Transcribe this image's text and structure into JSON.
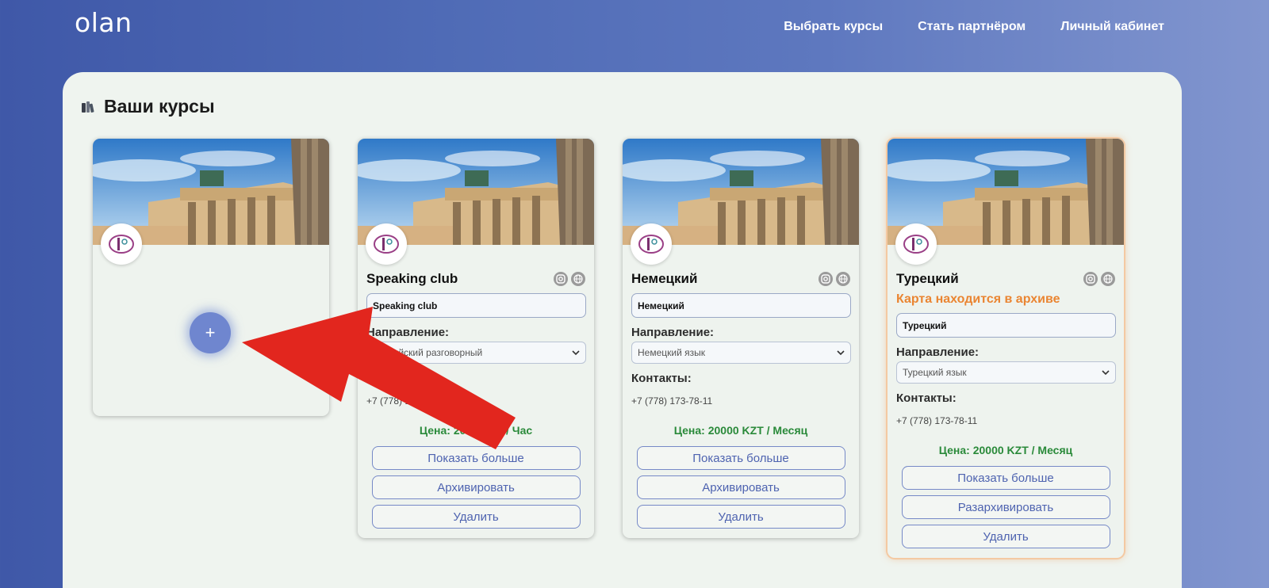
{
  "header": {
    "logo": "olan",
    "nav": [
      "Выбрать курсы",
      "Стать партнёром",
      "Личный кабинет"
    ]
  },
  "panel": {
    "title": "Ваши курсы"
  },
  "add_card": {
    "add_symbol": "+"
  },
  "courses": [
    {
      "title": "Speaking club",
      "name_value": "Speaking club",
      "direction_label": "Направление:",
      "direction_value": "Английский разговорный",
      "contacts_label": "Контакты:",
      "contact": "+7 (778) 173-78-11",
      "price": "Цена: 2000 KZT / Час",
      "buttons": [
        "Показать больше",
        "Архивировать",
        "Удалить"
      ]
    },
    {
      "title": "Немецкий",
      "name_value": "Немецкий",
      "direction_label": "Направление:",
      "direction_value": "Немецкий язык",
      "contacts_label": "Контакты:",
      "contact": "+7 (778) 173-78-11",
      "price": "Цена: 20000 KZT / Месяц",
      "buttons": [
        "Показать больше",
        "Архивировать",
        "Удалить"
      ]
    },
    {
      "title": "Турецкий",
      "archive_note": "Карта находится в архиве",
      "name_value": "Турецкий",
      "direction_label": "Направление:",
      "direction_value": "Турецкий язык",
      "contacts_label": "Контакты:",
      "contact": "+7 (778) 173-78-11",
      "price": "Цена: 20000 KZT / Месяц",
      "buttons": [
        "Показать больше",
        "Разархивировать",
        "Удалить"
      ]
    }
  ],
  "icons": {
    "instagram": "instagram-icon",
    "website": "globe-icon",
    "dropdown": "chevron-down-icon",
    "books": "books-icon",
    "annotation": "red-arrow-icon"
  },
  "colors": {
    "accent": "#4e63b0",
    "price": "#2a8a3a",
    "archive": "#ea8532",
    "annotation_arrow": "#e2261e"
  }
}
